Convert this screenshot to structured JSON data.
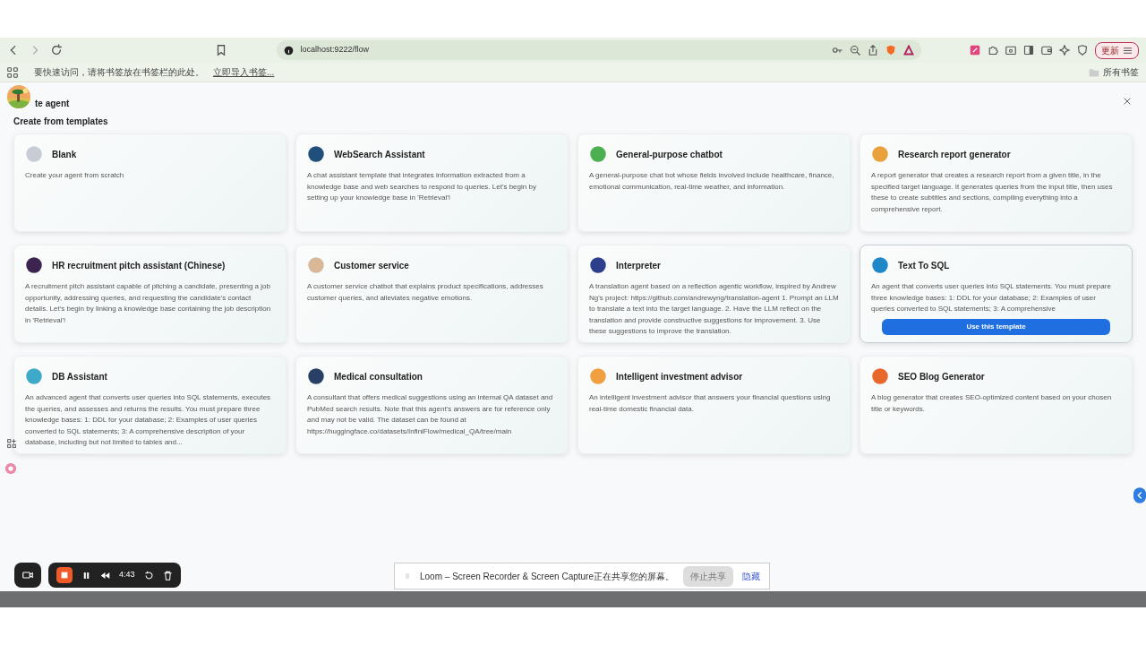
{
  "browser": {
    "url": "localhost:9222/flow",
    "update_button": "更新",
    "bookmarks_hint": "要快速访问，请将书签放在书签栏的此处。",
    "bookmarks_import": "立即导入书签...",
    "all_bookmarks": "所有书签"
  },
  "dialog": {
    "title": "te agent",
    "subtitle": "Create from templates",
    "hover_button": "Use this template"
  },
  "templates": [
    {
      "title": "Blank",
      "description": "Create your agent from scratch",
      "color": "#c8ccd4",
      "hovered": false
    },
    {
      "title": "WebSearch Assistant",
      "description": "A chat assistant template that integrates information extracted from a knowledge base and web searches to respond to queries. Let's begin by setting up your knowledge base in 'Retrieval'!",
      "color": "#1f4f7a",
      "hovered": false
    },
    {
      "title": "General-purpose chatbot",
      "description": "A general-purpose chat bot whose fields involved include healthcare, finance, emotional communication, real-time weather, and information.",
      "color": "#4caf50",
      "hovered": false
    },
    {
      "title": "Research report generator",
      "description": "A report generator that creates a research report from a given title, in the specified target language. It generates queries from the input title, then uses these to create subtitles and sections, compiling everything into a comprehensive report.",
      "color": "#e9a23b",
      "hovered": false
    },
    {
      "title": "HR recruitment pitch assistant (Chinese)",
      "description": "A recruitment pitch assistant capable of pitching a candidate, presenting a job opportunity, addressing queries, and requesting the candidate's contact details. Let's begin by linking a knowledge base containing the job description in 'Retrieval'!",
      "color": "#3b2550",
      "hovered": false
    },
    {
      "title": "Customer service",
      "description": "A customer service chatbot that explains product specifications, addresses customer queries, and alleviates negative emotions.",
      "color": "#d9b89a",
      "hovered": false
    },
    {
      "title": "Interpreter",
      "description": "A translation agent based on a reflection agentic workflow, inspired by Andrew Ng's project: https://github.com/andrewyng/translation-agent 1. Prompt an LLM to translate a text into the target language. 2. Have the LLM reflect on the translation and provide constructive suggestions for improvement. 3. Use these suggestions to improve the translation.",
      "color": "#2c3e8c",
      "hovered": false
    },
    {
      "title": "Text To SQL",
      "description": "An agent that converts user queries into SQL statements. You must prepare three knowledge bases: 1: DDL for your database; 2: Examples of user queries converted to SQL statements; 3: A comprehensive",
      "color": "#1e88c8",
      "hovered": true
    },
    {
      "title": "DB Assistant",
      "description": "An advanced agent that converts user queries into SQL statements, executes the queries, and assesses and returns the results. You must prepare three knowledge bases: 1: DDL for your database; 2: Examples of user queries converted to SQL statements; 3: A comprehensive description of your database, including but not limited to tables and...",
      "color": "#3fa9c9",
      "hovered": false
    },
    {
      "title": "Medical consultation",
      "description": "A consultant that offers medical suggestions using an internal QA dataset and PubMed search results. Note that this agent's answers are for reference only and may not be valid. The dataset can be found at https://huggingface.co/datasets/InfiniFlow/medical_QA/tree/main",
      "color": "#2a3f66",
      "hovered": false
    },
    {
      "title": "Intelligent investment advisor",
      "description": "An intelligent investment advisor that answers your financial questions using real-time domestic financial data.",
      "color": "#f0a040",
      "hovered": false
    },
    {
      "title": "SEO Blog Generator",
      "description": "A blog generator that creates SEO-optimized content based on your chosen title or keywords.",
      "color": "#e8672a",
      "hovered": false
    }
  ],
  "recorder": {
    "time": "4:43"
  },
  "share_bar": {
    "message": "Loom – Screen Recorder & Screen Capture正在共享您的屏幕。",
    "stop_button": "停止共享",
    "hide_link": "隐藏"
  }
}
